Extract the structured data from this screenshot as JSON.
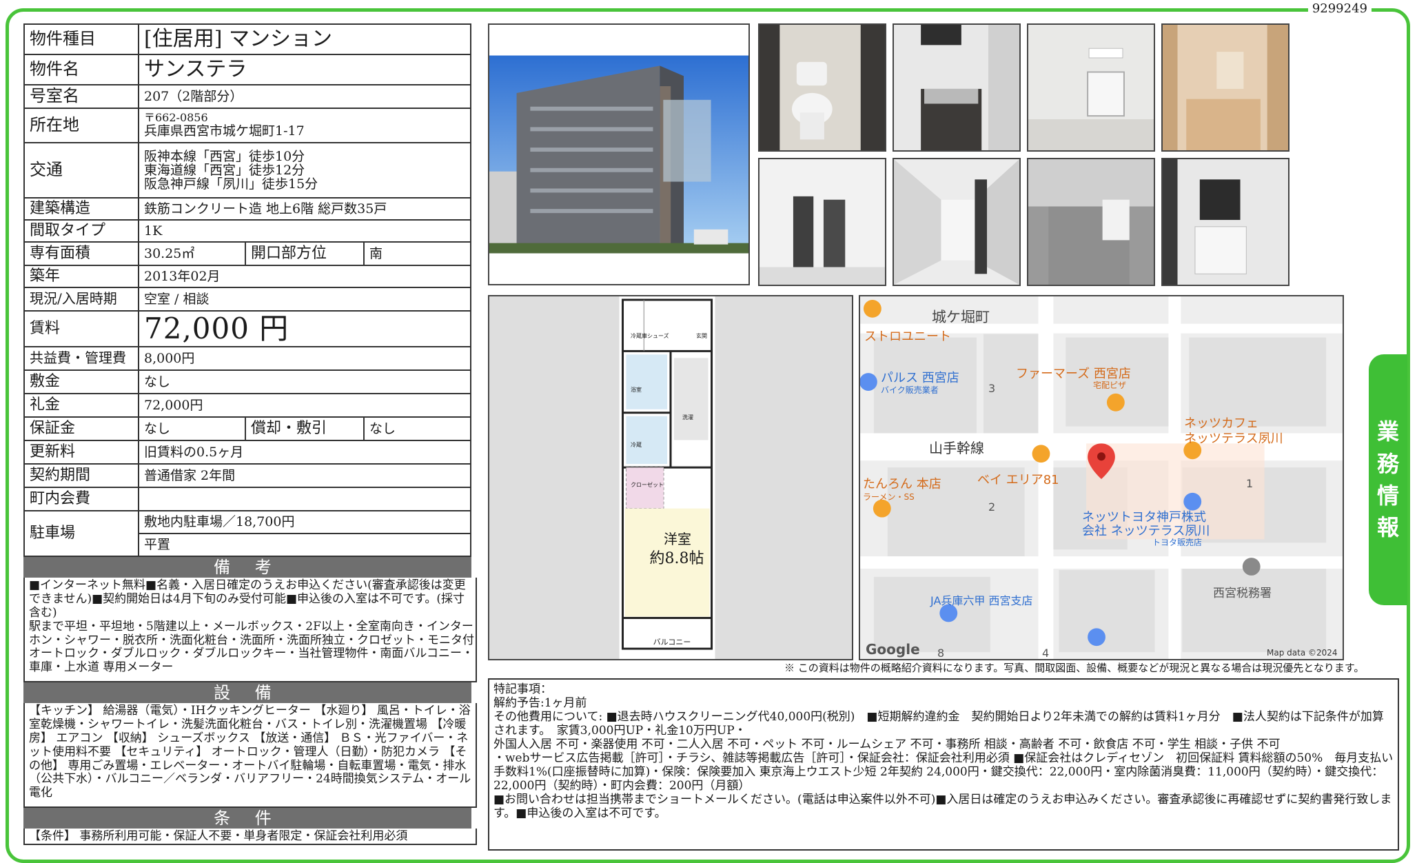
{
  "ref_id": "9299249",
  "side_tab": [
    "業",
    "務",
    "情",
    "報"
  ],
  "props": {
    "kind_label": "物件種目",
    "kind_value": "[住居用] マンション",
    "name_label": "物件名",
    "name_value": "サンステラ",
    "room_label": "号室名",
    "room_value": "207（2階部分）",
    "address_label": "所在地",
    "address_zip": "〒662-0856",
    "address_value": "兵庫県西宮市城ケ堀町1-17",
    "traffic_label": "交通",
    "traffic_lines": [
      "阪神本線「西宮」徒歩10分",
      "東海道線「西宮」徒歩12分",
      "阪急神戸線「夙川」徒歩15分"
    ],
    "structure_label": "建築構造",
    "structure_value": "鉄筋コンクリート造 地上6階 総戸数35戸",
    "layout_label": "間取タイプ",
    "layout_value": "1K",
    "area_label": "専有面積",
    "area_value": "30.25㎡",
    "direction_label": "開口部方位",
    "direction_value": "南",
    "built_label": "築年",
    "built_value": "2013年02月",
    "status_label": "現況/入居時期",
    "status_value": "空室 / 相談",
    "rent_label": "賃料",
    "rent_value": "72,000 円",
    "fee_label": "共益費・管理費",
    "fee_value": "8,000円",
    "deposit_label": "敷金",
    "deposit_value": "なし",
    "key_money_label": "礼金",
    "key_money_value": "72,000円",
    "guarantee_label": "保証金",
    "guarantee_value": "なし",
    "amort_label": "償却・敷引",
    "amort_value": "なし",
    "renewal_label": "更新料",
    "renewal_value": "旧賃料の0.5ヶ月",
    "contract_label": "契約期間",
    "contract_value": "普通借家 2年間",
    "community_label": "町内会費",
    "community_value": "",
    "parking_label": "駐車場",
    "parking_value_1": "敷地内駐車場／18,700円",
    "parking_value_2": "平置"
  },
  "remarks": {
    "heading": "備 考",
    "text": "■インターネット無料■名義・入居日確定のうえお申込ください(審査承認後は変更できません)■契約開始日は4月下旬のみ受付可能■申込後の入室は不可です。(採寸含む)\n駅まで平坦・平坦地・5階建以上・メールボックス・2F以上・全室南向き・インターホン・シャワー・脱衣所・洗面化粧台・洗面所・洗面所独立・クロゼット・モニタ付オートロック・ダブルロック・ダブルロックキー・当社管理物件・南面バルコニー・車庫・上水道 専用メーター"
  },
  "equipment": {
    "heading": "設 備",
    "text": "【キッチン】 給湯器（電気）・IHクッキングヒーター 【水廻り】 風呂・トイレ・浴室乾燥機・シャワートイレ・洗髪洗面化粧台・バス・トイレ別・洗濯機置場 【冷暖房】 エアコン 【収納】 シューズボックス 【放送・通信】 ＢＳ・光ファイバー・ネット使用料不要 【セキュリティ】 オートロック・管理人（日勤）・防犯カメラ 【その他】 専用ごみ置場・エレベーター・オートバイ駐輪場・自転車置場・電気・排水（公共下水）・バルコニー／ベランダ・バリアフリー・24時間換気システム・オール電化"
  },
  "conditions": {
    "heading": "条 件",
    "text": "【条件】 事務所利用可能・保証人不要・単身者限定・保証会社利用必須"
  },
  "floorplan": {
    "room_name": "洋室",
    "room_size": "約8.8帖",
    "balcony": "バルコニー",
    "labels": [
      "冷蔵庫",
      "洗濯",
      "浴室",
      "シューズ",
      "冷蔵",
      "玄関",
      "クローゼット"
    ]
  },
  "map": {
    "labels": [
      "城ケ堀町",
      "ストロユニート",
      "パルス 西宮店",
      "バイク販売業者",
      "ファーマーズ 西宮店",
      "宅配ピザ",
      "山手幹線",
      "ネッツカフェ",
      "ネッツテラス夙川",
      "たんろん 本店",
      "ラーメン・SS",
      "ベイ エリア81",
      "ネッツトヨタ神戸株式",
      "会社 ネッツテラス夙川",
      "トヨタ販売店",
      "西宮税務署",
      "JA兵庫六甲 西宮支店",
      "Google",
      "Map data ©2024"
    ],
    "numbers": [
      "3",
      "2",
      "1",
      "8",
      "4"
    ]
  },
  "disclaimer": "※ この資料は物件の概略紹介資料になります。写真、間取図面、設備、概要などが現況と異なる場合は現況優先となります。",
  "notes": {
    "title": "特記事項：",
    "text": "解約予告:1ヶ月前\nその他費用について: ■退去時ハウスクリーニング代40,000円(税別)　■短期解約違約金　契約開始日より2年未満での解約は賃料1ヶ月分　■法人契約は下記条件が加算されます。　家賃3,000円UP・礼金10万円UP・\n外国人入居 不可・楽器使用 不可・二人入居 不可・ペット 不可・ルームシェア 不可・事務所 相談・高齢者 不可・飲食店 不可・学生 相談・子供 不可\n・webサービス広告掲載［許可］・チラシ、雑誌等掲載広告［許可］・保証会社：保証会社利用必須 ■保証会社はクレディセゾン　初回保証料 賃料総額の50%　毎月支払い手数料1%(口座振替時に加算)・保険：保険要加入 東京海上ウエスト少短 2年契約 24,000円・鍵交換代：22,000円・室内除菌消臭費：11,000円（契約時）・鍵交換代：22,000円（契約時）・町内会費：200円（月額）\n■お問い合わせは担当携帯までショートメールください。(電話は申込案件以外不可)■入居日は確定のうえお申込みください。審査承認後に再確認せずに契約書発行致します。■申込後の入室は不可です。"
  }
}
